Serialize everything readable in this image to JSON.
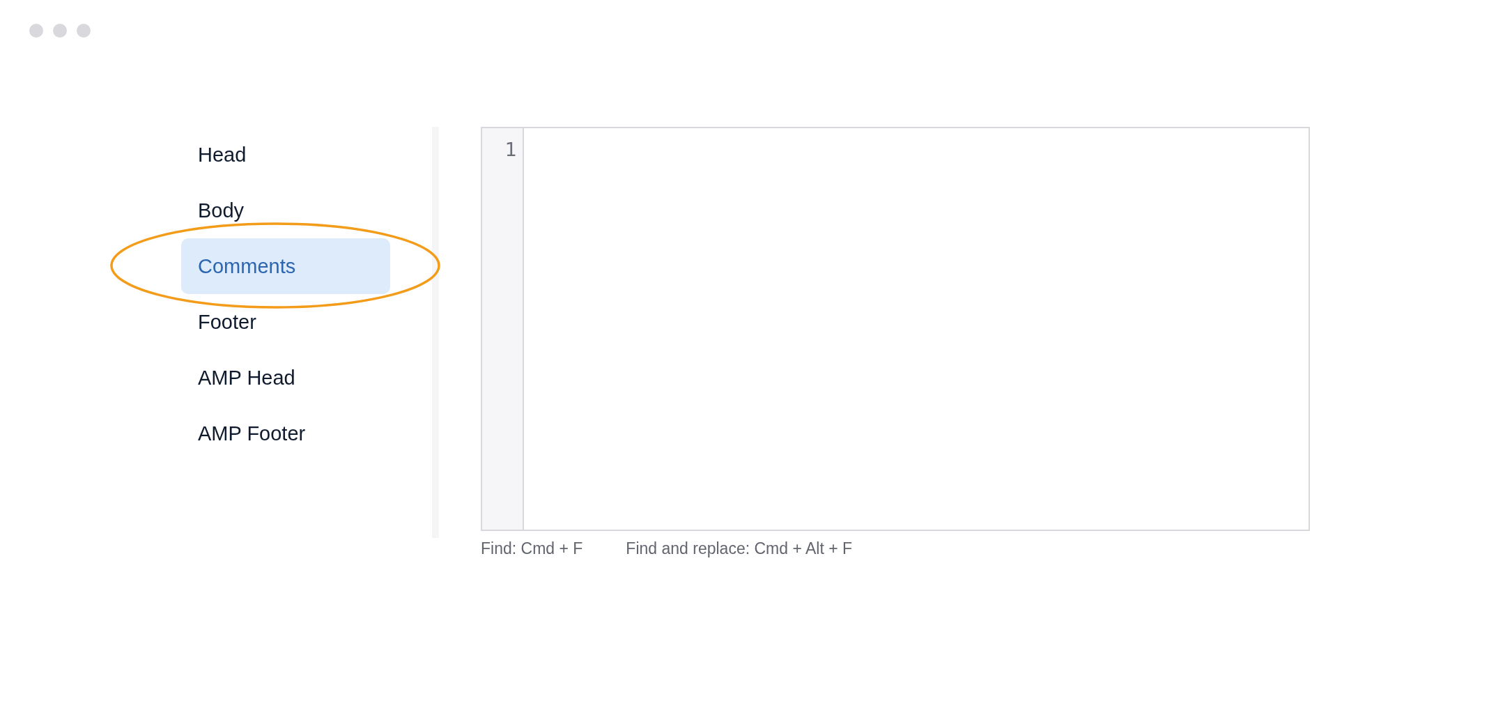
{
  "sidebar": {
    "items": [
      {
        "label": "Head",
        "selected": false
      },
      {
        "label": "Body",
        "selected": false
      },
      {
        "label": "Comments",
        "selected": true
      },
      {
        "label": "Footer",
        "selected": false
      },
      {
        "label": "AMP Head",
        "selected": false
      },
      {
        "label": "AMP Footer",
        "selected": false
      }
    ]
  },
  "editor": {
    "line_numbers": [
      "1"
    ]
  },
  "hints": [
    "Find: Cmd + F",
    "Find and replace: Cmd + Alt + F"
  ]
}
